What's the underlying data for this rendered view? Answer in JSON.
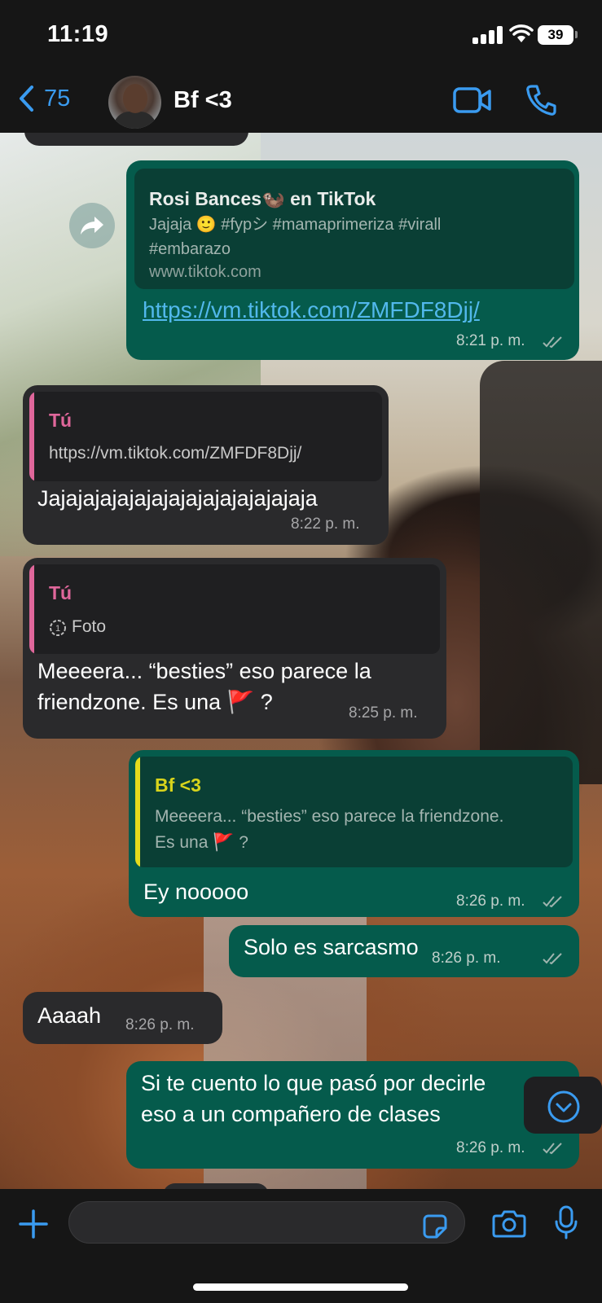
{
  "status": {
    "time": "11:19",
    "battery": "39"
  },
  "header": {
    "back_count": "75",
    "contact_name": "Bf <3"
  },
  "messages": {
    "m1": {
      "card_title": "Rosi Bances🦦 en TikTok",
      "card_desc": "Jajaja 🙂 #fypシ #mamaprimeriza #virall #embarazo",
      "card_domain": "www.tiktok.com",
      "url": "https://vm.tiktok.com/ZMFDF8Djj/",
      "time": "8:21 p. m."
    },
    "m2": {
      "quote_author": "Tú",
      "quote_text": "https://vm.tiktok.com/ZMFDF8Djj/",
      "text": "Jajajajajajajajajajajajajajajaja",
      "time": "8:22 p. m."
    },
    "m3": {
      "quote_author": "Tú",
      "quote_text": "Foto",
      "text_line1": "Meeeera... “besties” eso parece la",
      "text_line2": "friendzone. Es una 🚩 ?",
      "time": "8:25 p. m."
    },
    "m4": {
      "quote_author": "Bf <3",
      "quote_line1": "Meeeera... “besties” eso parece la friendzone.",
      "quote_line2": "Es una 🚩 ?",
      "text": "Ey nooooo",
      "time": "8:26 p. m."
    },
    "m5": {
      "text": "Solo es sarcasmo",
      "time": "8:26 p. m."
    },
    "m6": {
      "text": "Aaaah",
      "time": "8:26 p. m."
    },
    "m7": {
      "text_line1": "Si te cuento lo que pasó por decirle",
      "text_line2": "eso a un compañero de clases",
      "time": "8:26 p. m."
    }
  },
  "colors": {
    "accent": "#3a9bf0",
    "outgoing_bubble": "#055b4c",
    "incoming_bubble": "#2a2a2c",
    "quote_me": "#e0679b",
    "quote_contact": "#e5dc1c"
  },
  "icons": [
    "back-chevron-icon",
    "video-call-icon",
    "phone-icon",
    "forward-icon",
    "view-once-icon",
    "double-check-icon",
    "chevron-down-icon",
    "plus-icon",
    "sticker-icon",
    "camera-icon",
    "microphone-icon"
  ]
}
